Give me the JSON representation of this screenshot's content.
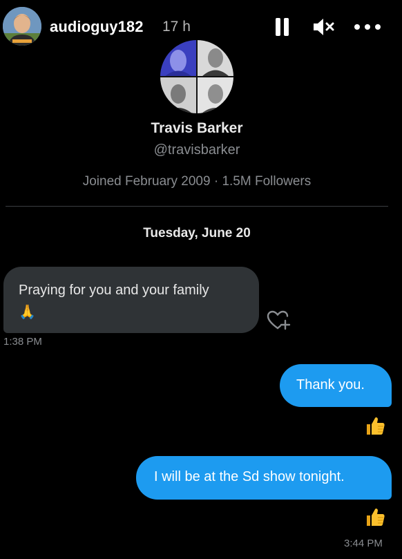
{
  "story": {
    "username": "audioguy182",
    "time_ago": "17 h",
    "avatar_icon": "user-avatar-icon",
    "controls": [
      "pause-icon",
      "mute-icon",
      "more-icon"
    ]
  },
  "profile": {
    "name": "Travis Barker",
    "handle": "@travisbarker",
    "meta": "Joined February 2009 · 1.5M Followers"
  },
  "conversation": {
    "date": "Tuesday, June 20",
    "messages": [
      {
        "direction": "incoming",
        "text": "Praying for you and your family",
        "emoji": "🙏",
        "time": "1:38 PM"
      },
      {
        "direction": "outgoing",
        "text": "Thank you.",
        "reaction": "👍"
      },
      {
        "direction": "outgoing",
        "text": "I will be at the Sd show tonight.",
        "reaction": "👍",
        "time": "3:44 PM"
      }
    ]
  },
  "colors": {
    "background": "#000000",
    "incoming_bubble": "#2f3336",
    "outgoing_bubble": "#1d9bf0",
    "muted_text": "#8a8d91"
  }
}
